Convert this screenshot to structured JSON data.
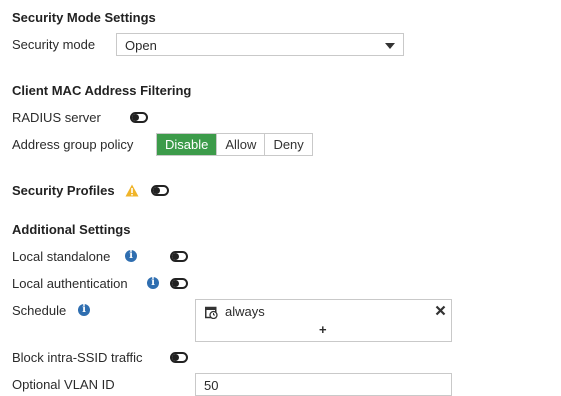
{
  "security_mode_settings": {
    "heading": "Security Mode Settings",
    "mode_label": "Security mode",
    "mode_value": "Open"
  },
  "mac_filtering": {
    "heading": "Client MAC Address Filtering",
    "radius_label": "RADIUS server",
    "radius_enabled": false,
    "policy_label": "Address group policy",
    "policy_options": [
      "Disable",
      "Allow",
      "Deny"
    ],
    "policy_selected": "Disable"
  },
  "security_profiles": {
    "label": "Security Profiles",
    "warning_icon": "warning-icon",
    "enabled": false
  },
  "additional_settings": {
    "heading": "Additional Settings",
    "local_standalone_label": "Local standalone",
    "local_standalone_enabled": false,
    "local_auth_label": "Local authentication",
    "local_auth_enabled": false,
    "schedule_label": "Schedule",
    "schedule_value": "always",
    "schedule_add": "+",
    "block_intra_ssid_label": "Block intra-SSID traffic",
    "block_intra_ssid_enabled": false,
    "optional_vlan_label": "Optional VLAN ID",
    "optional_vlan_value": "50"
  },
  "colors": {
    "accent_green": "#3c9b4a",
    "info_blue": "#2f6eb0",
    "warning_yellow": "#f0b429"
  }
}
